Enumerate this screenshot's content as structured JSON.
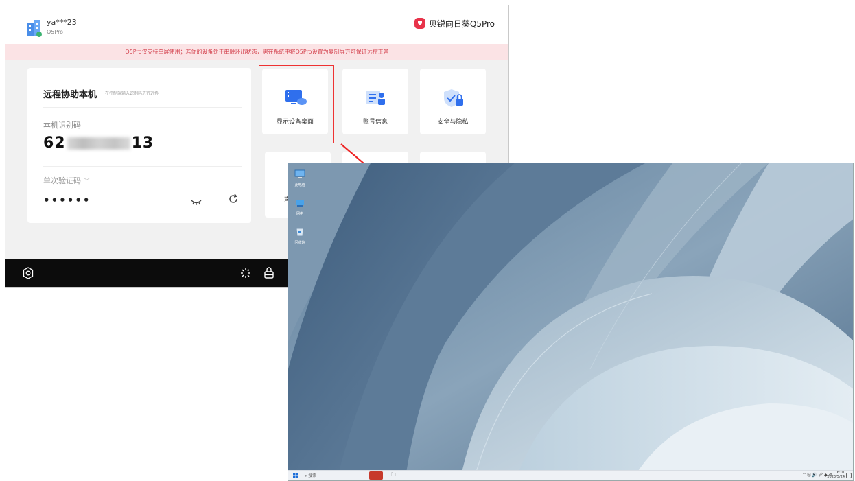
{
  "app": {
    "user": {
      "name": "ya***23",
      "device": "Q5Pro"
    },
    "brand": {
      "name": "贝锐向日葵Q5Pro",
      "color": "#e8334a"
    },
    "notice": "Q5Pro仅支持单屏使用；若你的设备处于串联环出状态，需在系统中将Q5Pro设置为复制屏方可保证远控正常",
    "remote": {
      "title": "远程协助本机",
      "hint": "在控制端输入识别码进行远协",
      "id_label": "本机识别码",
      "id_prefix": "62",
      "id_suffix": "13",
      "code_label": "单次验证码",
      "code_value": "••••••"
    },
    "tiles": [
      {
        "label": "显示设备桌面",
        "icon": "desktop-display-icon"
      },
      {
        "label": "账号信息",
        "icon": "account-info-icon"
      },
      {
        "label": "安全与隐私",
        "icon": "security-privacy-icon"
      },
      {
        "label": "声",
        "icon": "sound-icon"
      }
    ],
    "footer_icons": [
      "settings-gear-icon",
      "loading-spinner-icon",
      "lock-icon"
    ]
  },
  "desktop": {
    "icons": [
      {
        "label": "此电脑",
        "icon": "this-pc-icon"
      },
      {
        "label": "网络",
        "icon": "network-icon"
      },
      {
        "label": "回收站",
        "icon": "recycle-bin-icon"
      }
    ],
    "taskbar": {
      "search": "搜索",
      "tray": "^ 🖫 🔊 🖉 ◆ ⚙",
      "time": "16:01",
      "date": "2023/5/24"
    }
  },
  "colors": {
    "highlight": "#ee3333",
    "accent": "#2f6fed",
    "notice_bg": "#fbe3e5"
  }
}
